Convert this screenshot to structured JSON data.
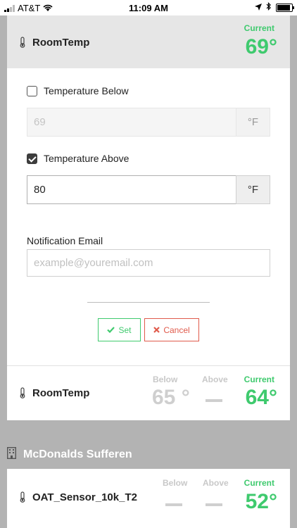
{
  "status_bar": {
    "carrier": "AT&T",
    "time": "11:09 AM"
  },
  "editor": {
    "sensor_name": "RoomTemp",
    "current_label": "Current",
    "current_value": "69°",
    "below": {
      "label": "Temperature Below",
      "checked": false,
      "value": "69",
      "unit": "°F"
    },
    "above": {
      "label": "Temperature Above",
      "checked": true,
      "value": "80",
      "unit": "°F"
    },
    "email": {
      "label": "Notification Email",
      "placeholder": "example@youremail.com"
    },
    "set_button": "Set",
    "cancel_button": "Cancel"
  },
  "summary_row": {
    "sensor_name": "RoomTemp",
    "below_label": "Below",
    "above_label": "Above",
    "current_label": "Current",
    "below_value": "65 °",
    "current_value": "64°"
  },
  "group": {
    "title": "McDonalds Sufferen",
    "row": {
      "sensor_name": "OAT_Sensor_10k_T2",
      "below_label": "Below",
      "above_label": "Above",
      "current_label": "Current",
      "current_value": "52°"
    }
  },
  "colors": {
    "accent_green": "#3fca6e",
    "cancel_red": "#e05a4b",
    "background_gray": "#b3b3b3"
  }
}
